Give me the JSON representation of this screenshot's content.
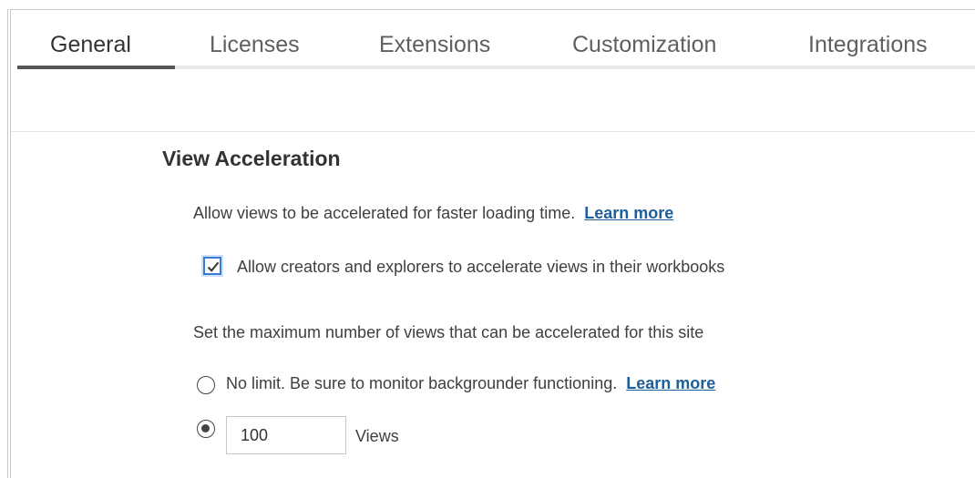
{
  "tabs": [
    {
      "label": "General",
      "active": true
    },
    {
      "label": "Licenses",
      "active": false
    },
    {
      "label": "Extensions",
      "active": false
    },
    {
      "label": "Customization",
      "active": false
    },
    {
      "label": "Integrations",
      "active": false
    }
  ],
  "section": {
    "title": "View Acceleration",
    "description": "Allow views to be accelerated for faster loading time.",
    "description_link": "Learn more",
    "checkbox_label": "Allow creators and explorers to accelerate views in their workbooks",
    "checkbox_checked": true,
    "max_views_prompt": "Set the maximum number of views that can be accelerated for this site",
    "option_no_limit_label": "No limit. Be sure to monitor backgrounder functioning.",
    "option_no_limit_link": "Learn more",
    "option_no_limit_selected": false,
    "option_limit_selected": true,
    "limit_value": "100",
    "limit_unit": "Views"
  },
  "colors": {
    "link": "#1f5f99",
    "checkbox_border": "#3a7bd5",
    "active_tab_bar": "#555555"
  }
}
